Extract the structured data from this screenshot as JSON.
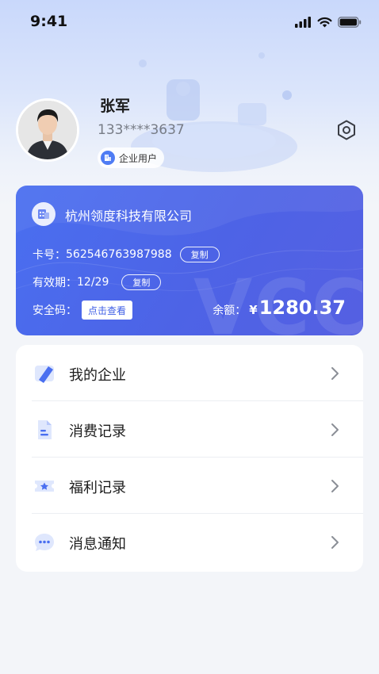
{
  "status_bar": {
    "time": "9:41"
  },
  "profile": {
    "name": "张军",
    "phone": "133****3637",
    "badge": "企业用户"
  },
  "card": {
    "company": "杭州领度科技有限公司",
    "card_number_label": "卡号：",
    "card_number": "562546763987988",
    "copy_label": "复制",
    "validity_label": "有效期：",
    "validity": "12/29",
    "security_label": "安全码：",
    "view_label": "点击查看",
    "balance_label": "余额：",
    "balance_currency": "¥",
    "balance_amount": "1280.37",
    "watermark": "VCC"
  },
  "menu": {
    "items": [
      {
        "label": "我的企业",
        "icon": "company-icon"
      },
      {
        "label": "消费记录",
        "icon": "document-icon"
      },
      {
        "label": "福利记录",
        "icon": "ticket-icon"
      },
      {
        "label": "消息通知",
        "icon": "chat-icon"
      }
    ]
  },
  "colors": {
    "accent": "#4a6ff0",
    "card_end": "#5560e2",
    "background": "#f3f5f9"
  }
}
